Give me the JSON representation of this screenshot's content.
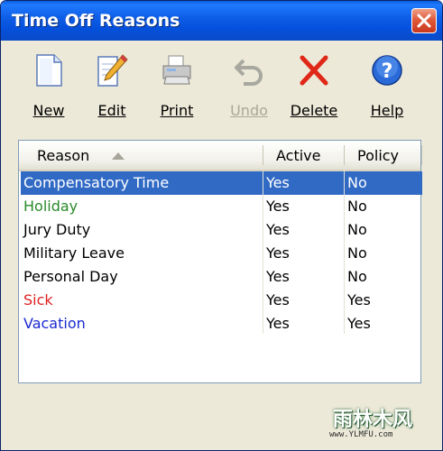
{
  "window": {
    "title": "Time Off Reasons"
  },
  "toolbar": {
    "new_label": "New",
    "edit_label": "Edit",
    "print_label": "Print",
    "undo_label": "Undo",
    "delete_label": "Delete",
    "help_label": "Help"
  },
  "grid": {
    "columns": [
      "Reason",
      "Active",
      "Policy"
    ],
    "sort_column": "Reason",
    "sort_direction": "ascending",
    "rows": [
      {
        "reason": "Compensatory Time",
        "active": "Yes",
        "policy": "No",
        "color": "#ffffff",
        "selected": true
      },
      {
        "reason": "Holiday",
        "active": "Yes",
        "policy": "No",
        "color": "#2a8a2a",
        "selected": false
      },
      {
        "reason": "Jury Duty",
        "active": "Yes",
        "policy": "No",
        "color": "#000000",
        "selected": false
      },
      {
        "reason": "Military Leave",
        "active": "Yes",
        "policy": "No",
        "color": "#000000",
        "selected": false
      },
      {
        "reason": "Personal Day",
        "active": "Yes",
        "policy": "No",
        "color": "#000000",
        "selected": false
      },
      {
        "reason": "Sick",
        "active": "Yes",
        "policy": "Yes",
        "color": "#e02020",
        "selected": false
      },
      {
        "reason": "Vacation",
        "active": "Yes",
        "policy": "Yes",
        "color": "#1a2ad0",
        "selected": false
      }
    ]
  },
  "watermark": {
    "text": "雨林木风",
    "url": "www.YLMFU.com"
  },
  "colors": {
    "titlebar": "#0550dc",
    "selection": "#316ac5",
    "dialog_bg": "#ece9d8"
  }
}
